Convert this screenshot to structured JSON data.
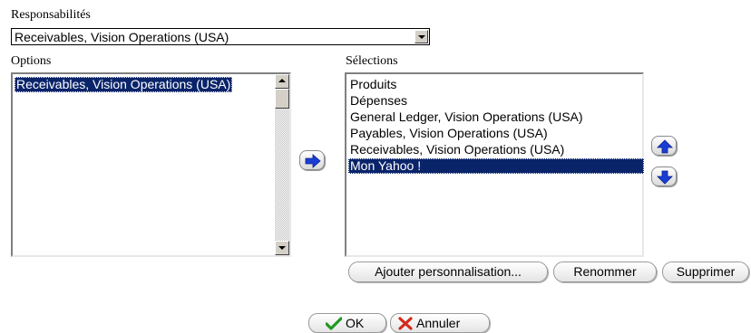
{
  "responsabilites": {
    "label": "Responsabilités",
    "selected": "Receivables, Vision Operations (USA)"
  },
  "options": {
    "label": "Options",
    "items": [
      "Receivables, Vision Operations (USA)"
    ],
    "selected_index": 0
  },
  "selections": {
    "label": "Sélections",
    "items": [
      "Produits",
      "Dépenses",
      "General Ledger, Vision Operations (USA)",
      "Payables, Vision Operations (USA)",
      "Receivables, Vision Operations (USA)",
      "Mon Yahoo !"
    ],
    "selected_index": 5
  },
  "buttons": {
    "add_personalization": "Ajouter personnalisation...",
    "rename": "Renommer",
    "delete": "Supprimer",
    "ok": "OK",
    "cancel": "Annuler"
  },
  "icons": {
    "move_right": "arrow-right-icon",
    "move_up": "arrow-up-icon",
    "move_down": "arrow-down-icon",
    "ok": "checkmark-icon",
    "cancel": "x-icon"
  },
  "colors": {
    "selection_bg": "#0a246a",
    "arrow_blue": "#1a3ed4"
  }
}
